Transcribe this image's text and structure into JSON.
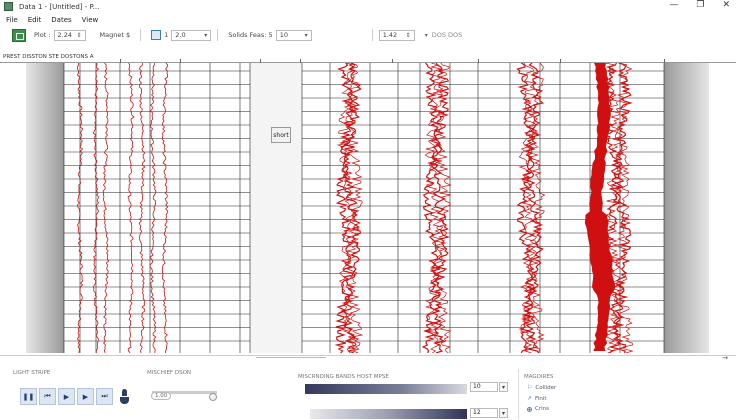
{
  "window": {
    "title": "Data 1 - [Untitled] - P...",
    "controls": {
      "minimize": "—",
      "restore": "❐",
      "close": "✕"
    }
  },
  "menu": [
    {
      "label": "File"
    },
    {
      "label": "Edit"
    },
    {
      "label": "Dates"
    },
    {
      "label": "View"
    }
  ],
  "toolbar": {
    "plot_label": "Plot :",
    "plot_value": "2.24",
    "magnet_label": "Magnet $",
    "scale_value": "2.0",
    "scale_prefix": "1",
    "solids_label": "Solids Feas: 5",
    "solids_value": "10",
    "zoom_value": "1.42",
    "extra_label": "DOS DOS"
  },
  "ruler": {
    "label": "PREST DISSTON STE DOSTONS A"
  },
  "annotation": {
    "label": "short"
  },
  "bottom": {
    "playback_title": "LIGHT STRIPE",
    "volume_title": "MISCHIEF DSON",
    "volume_value": "1.00",
    "gradient_title": "MISCRNDING BANDS HOST MPSE",
    "gradient_top_value": "10",
    "gradient_bottom_value": "12",
    "modes_title": "MAGDIRES",
    "modes": [
      {
        "label": "Collider",
        "selected": false
      },
      {
        "label": "Finit",
        "selected": false
      },
      {
        "label": "Crins",
        "selected": true
      }
    ],
    "buttons": [
      {
        "icon": "pause-icon",
        "glyph": "❚❚"
      },
      {
        "icon": "skip-back-icon",
        "glyph": "⏮"
      },
      {
        "icon": "play-icon",
        "glyph": "▶"
      },
      {
        "icon": "step-forward-icon",
        "glyph": "▶"
      },
      {
        "icon": "skip-forward-icon",
        "glyph": "⏭"
      }
    ]
  },
  "colors": {
    "trace": "#d01010",
    "grid": "#222222",
    "accent": "#2d5fa3",
    "toolbar_icon": "#3e8f4f"
  }
}
